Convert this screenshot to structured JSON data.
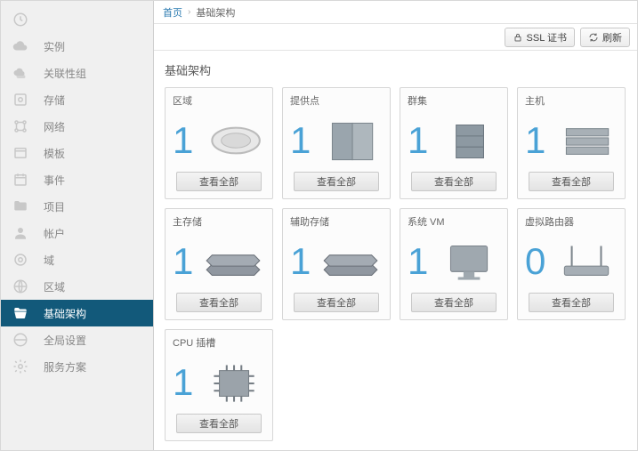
{
  "breadcrumb": {
    "home": "首页",
    "current": "基础架构"
  },
  "toolbar": {
    "ssl": "SSL 证书",
    "refresh": "刷新"
  },
  "sidebar": {
    "items": [
      {
        "label": ""
      },
      {
        "label": "实例"
      },
      {
        "label": "关联性组"
      },
      {
        "label": "存储"
      },
      {
        "label": "网络"
      },
      {
        "label": "模板"
      },
      {
        "label": "事件"
      },
      {
        "label": "项目"
      },
      {
        "label": "帐户"
      },
      {
        "label": "域"
      },
      {
        "label": "区域"
      },
      {
        "label": "基础架构"
      },
      {
        "label": "全局设置"
      },
      {
        "label": "服务方案"
      }
    ],
    "active": 11
  },
  "section_title": "基础架构",
  "view_all_label": "查看全部",
  "cards": [
    {
      "title": "区域",
      "count": 1
    },
    {
      "title": "提供点",
      "count": 1
    },
    {
      "title": "群集",
      "count": 1
    },
    {
      "title": "主机",
      "count": 1
    },
    {
      "title": "主存储",
      "count": 1
    },
    {
      "title": "辅助存储",
      "count": 1
    },
    {
      "title": "系统 VM",
      "count": 1
    },
    {
      "title": "虚拟路由器",
      "count": 0
    },
    {
      "title": "CPU 插槽",
      "count": 1
    }
  ]
}
